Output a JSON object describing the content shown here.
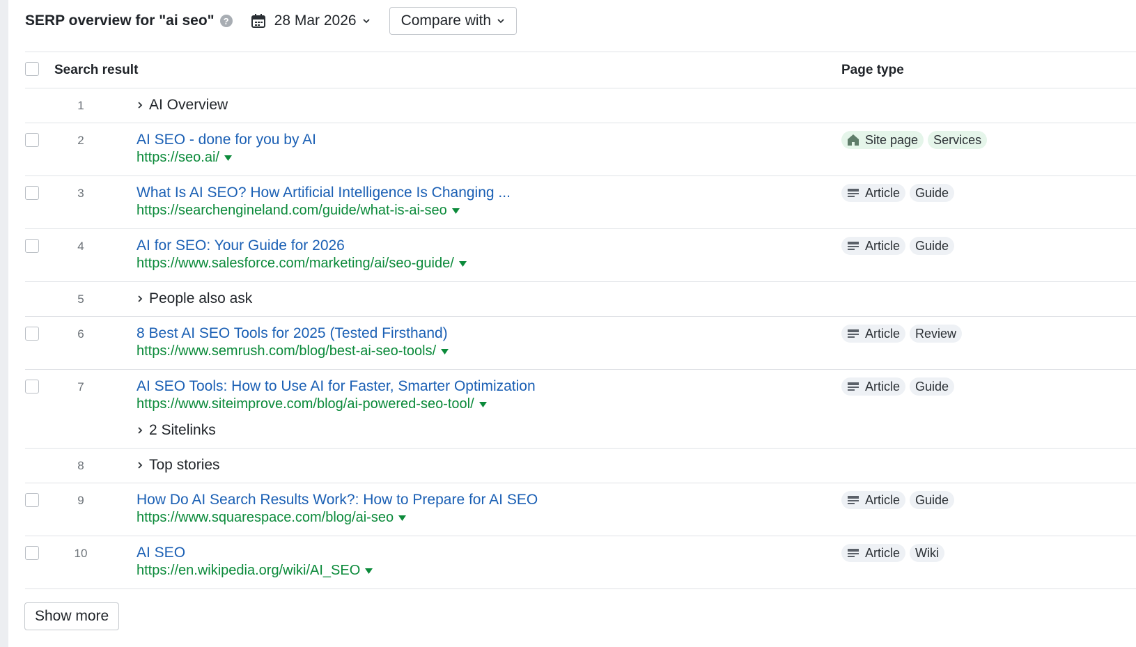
{
  "header": {
    "title": "SERP overview for \"ai seo\"",
    "date": "28 Mar 2026",
    "compare_label": "Compare with"
  },
  "table": {
    "col_search_result": "Search result",
    "col_page_type": "Page type",
    "rows": [
      {
        "pos": "1",
        "kind": "feature",
        "label": "AI Overview"
      },
      {
        "pos": "2",
        "kind": "result",
        "title": "AI SEO - done for you by AI",
        "url": "https://seo.ai/",
        "tags": [
          "Site page",
          "Services"
        ],
        "tag_icon": "home-icon"
      },
      {
        "pos": "3",
        "kind": "result",
        "title": "What Is AI SEO? How Artificial Intelligence Is Changing ...",
        "url": "https://searchengineland.com/guide/what-is-ai-seo",
        "tags": [
          "Article",
          "Guide"
        ],
        "tag_icon": "article-icon"
      },
      {
        "pos": "4",
        "kind": "result",
        "title": "AI for SEO: Your Guide for 2026",
        "url": "https://www.salesforce.com/marketing/ai/seo-guide/",
        "tags": [
          "Article",
          "Guide"
        ],
        "tag_icon": "article-icon"
      },
      {
        "pos": "5",
        "kind": "feature",
        "label": "People also ask"
      },
      {
        "pos": "6",
        "kind": "result",
        "title": "8 Best AI SEO Tools for 2025 (Tested Firsthand)",
        "url": "https://www.semrush.com/blog/best-ai-seo-tools/",
        "tags": [
          "Article",
          "Review"
        ],
        "tag_icon": "article-icon"
      },
      {
        "pos": "7",
        "kind": "result",
        "title": "AI SEO Tools: How to Use AI for Faster, Smarter Optimization",
        "url": "https://www.siteimprove.com/blog/ai-powered-seo-tool/",
        "tags": [
          "Article",
          "Guide"
        ],
        "tag_icon": "article-icon",
        "sitelinks": "2 Sitelinks"
      },
      {
        "pos": "8",
        "kind": "feature",
        "label": "Top stories"
      },
      {
        "pos": "9",
        "kind": "result",
        "title": "How Do AI Search Results Work?: How to Prepare for AI SEO",
        "url": "https://www.squarespace.com/blog/ai-seo",
        "tags": [
          "Article",
          "Guide"
        ],
        "tag_icon": "article-icon"
      },
      {
        "pos": "10",
        "kind": "result",
        "title": "AI SEO",
        "url": "https://en.wikipedia.org/wiki/AI_SEO",
        "tags": [
          "Article",
          "Wiki"
        ],
        "tag_icon": "article-icon"
      }
    ]
  },
  "show_more_label": "Show more",
  "colors": {
    "link": "#1a5fb4",
    "url": "#0b8a3a",
    "tag_bg": "#eef1f5",
    "tag_site_bg": "#e5f5ea"
  }
}
